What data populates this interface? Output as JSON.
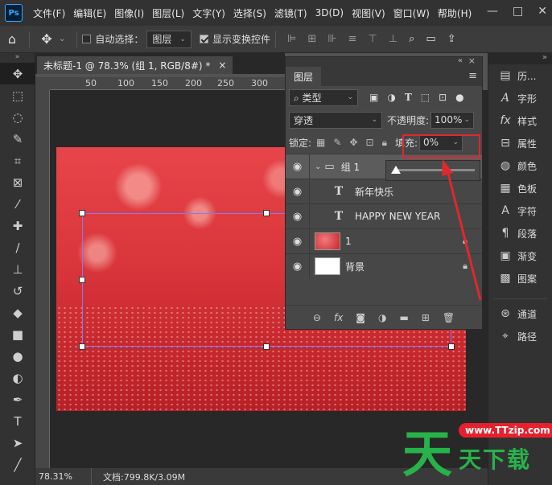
{
  "app": {
    "logo": "Ps"
  },
  "menu": [
    "文件(F)",
    "编辑(E)",
    "图像(I)",
    "图层(L)",
    "文字(Y)",
    "选择(S)",
    "滤镜(T)",
    "3D(D)",
    "视图(V)",
    "窗口(W)",
    "帮助(H)"
  ],
  "window_controls": {
    "minimize": "—",
    "maximize": "□",
    "close": "✕"
  },
  "options_bar": {
    "home_icon": "⌂",
    "move_icon": "✥",
    "auto_select_label": "自动选择：",
    "auto_select_checked": false,
    "auto_select_target": "图层",
    "show_transform_label": "显示变换控件",
    "show_transform_checked": true
  },
  "document": {
    "tab_title": "未标题-1 @ 78.3% (组 1, RGB/8#) *",
    "tab_close": "×",
    "ruler_ticks": [
      "50",
      "100",
      "150",
      "200",
      "250",
      "300"
    ],
    "zoom": "78.31%",
    "doc_info": "文档:799.8K/3.09M"
  },
  "layers_panel": {
    "tab_label": "图层",
    "filter_kind": "类型",
    "blend_mode": "穿透",
    "opacity_label": "不透明度:",
    "opacity_value": "100%",
    "lock_label": "锁定:",
    "fill_label": "填充:",
    "fill_value": "0%",
    "fill_slider_level": 0,
    "layers": [
      {
        "name": "组 1",
        "type": "group",
        "selected": true
      },
      {
        "name": "新年快乐",
        "type": "text"
      },
      {
        "name": "HAPPY NEW YEAR",
        "type": "text"
      },
      {
        "name": "1",
        "type": "image",
        "locked": true
      },
      {
        "name": "背景",
        "type": "background",
        "locked": true
      }
    ]
  },
  "right_panel": {
    "group1": [
      {
        "icon": "history-icon",
        "label": "历..."
      },
      {
        "icon": "glyph-icon",
        "label": "字形"
      },
      {
        "icon": "styles-icon",
        "label": "样式"
      },
      {
        "icon": "properties-icon",
        "label": "属性"
      },
      {
        "icon": "color-icon",
        "label": "颜色"
      },
      {
        "icon": "swatches-icon",
        "label": "色板"
      },
      {
        "icon": "character-icon",
        "label": "字符"
      },
      {
        "icon": "paragraph-icon",
        "label": "段落"
      },
      {
        "icon": "gradient-icon",
        "label": "渐变"
      },
      {
        "icon": "patterns-icon",
        "label": "图案"
      }
    ],
    "group2": [
      {
        "icon": "channels-icon",
        "label": "通道"
      },
      {
        "icon": "paths-icon",
        "label": "路径"
      }
    ]
  },
  "watermark": {
    "big": "天",
    "url": "www.TTzip.com",
    "small": "天下载"
  },
  "colors": {
    "highlight": "#e0282e",
    "watermark_green": "#27b24a",
    "watermark_red": "#e7202d"
  }
}
